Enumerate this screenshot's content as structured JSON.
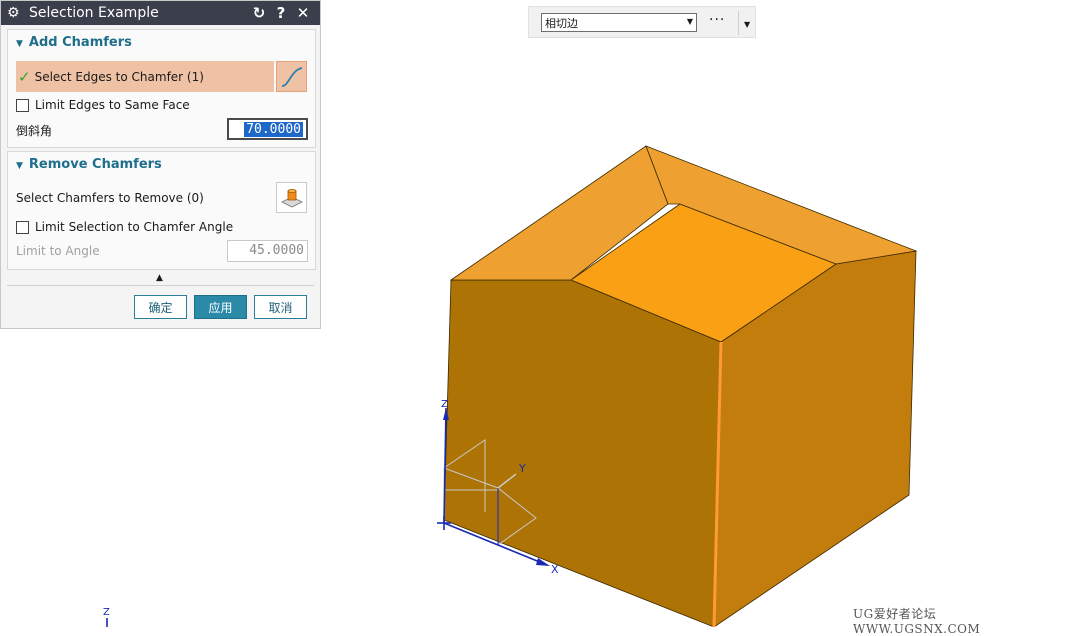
{
  "dialog": {
    "title": "Selection Example",
    "title_buttons": [
      "↻",
      "?",
      "✕"
    ],
    "add_group": {
      "header": "Add Chamfers",
      "select_edges_label": "Select Edges to Chamfer (1)",
      "limit_same_face_label": "Limit Edges to Same Face",
      "chamfer_angle_label": "倒斜角",
      "chamfer_angle_value": "70.0000"
    },
    "remove_group": {
      "header": "Remove Chamfers",
      "select_remove_label": "Select Chamfers to Remove  (0)",
      "limit_angle_checkbox_label": "Limit Selection to Chamfer Angle",
      "limit_angle_label": "Limit to Angle",
      "limit_angle_value": "45.0000"
    },
    "buttons": {
      "ok": "确定",
      "apply": "应用",
      "cancel": "取消"
    }
  },
  "toolbar": {
    "filter_value": "相切边",
    "more_label": "···"
  },
  "viewport": {
    "triad_labels": {
      "x": "X",
      "y": "Y",
      "z": "Z"
    },
    "corner_triad_label": "Z",
    "watermark": "UG爱好者论坛 WWW.UGSNX.COM"
  },
  "colors": {
    "accent": "#2b8aa8",
    "selection_highlight": "#efc2a6",
    "solid_face_top": "#f9a014",
    "solid_face_left": "#ad7405",
    "solid_face_right": "#c37d0c",
    "chamfer_face": "#eea130",
    "selected_edge": "#ff9a35"
  }
}
